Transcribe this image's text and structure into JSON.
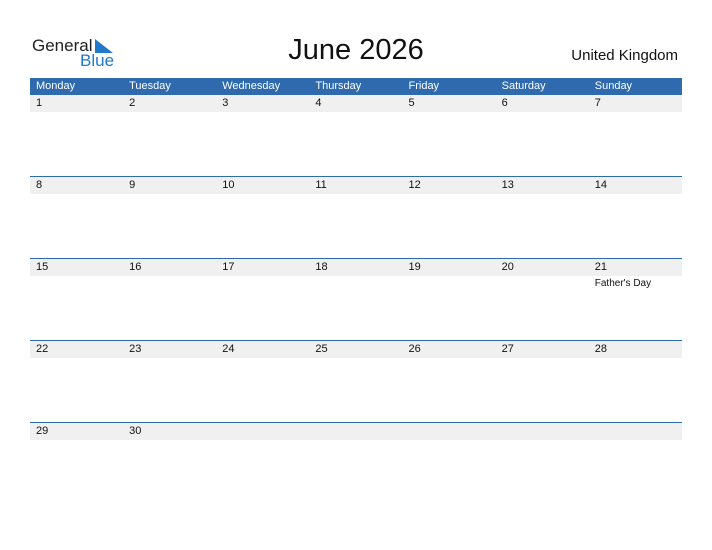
{
  "logo": {
    "general": "General",
    "blue": "Blue"
  },
  "title": "June 2026",
  "country": "United Kingdom",
  "days": [
    "Monday",
    "Tuesday",
    "Wednesday",
    "Thursday",
    "Friday",
    "Saturday",
    "Sunday"
  ],
  "weeks": [
    {
      "dates": [
        "1",
        "2",
        "3",
        "4",
        "5",
        "6",
        "7"
      ],
      "events": [
        "",
        "",
        "",
        "",
        "",
        "",
        ""
      ]
    },
    {
      "dates": [
        "8",
        "9",
        "10",
        "11",
        "12",
        "13",
        "14"
      ],
      "events": [
        "",
        "",
        "",
        "",
        "",
        "",
        ""
      ]
    },
    {
      "dates": [
        "15",
        "16",
        "17",
        "18",
        "19",
        "20",
        "21"
      ],
      "events": [
        "",
        "",
        "",
        "",
        "",
        "",
        "Father's Day"
      ]
    },
    {
      "dates": [
        "22",
        "23",
        "24",
        "25",
        "26",
        "27",
        "28"
      ],
      "events": [
        "",
        "",
        "",
        "",
        "",
        "",
        ""
      ]
    },
    {
      "dates": [
        "29",
        "30",
        "",
        "",
        "",
        "",
        ""
      ],
      "events": [
        "",
        "",
        "",
        "",
        "",
        "",
        ""
      ]
    }
  ]
}
